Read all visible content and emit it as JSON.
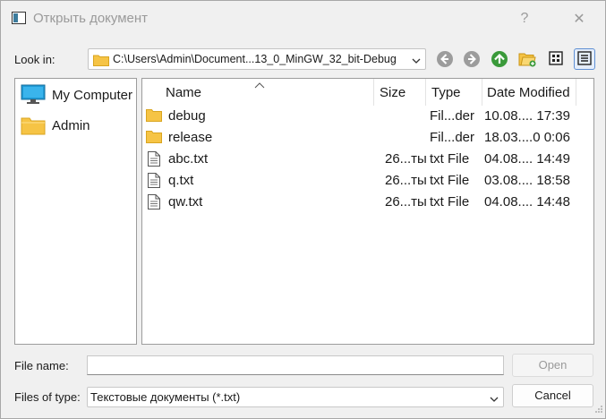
{
  "window": {
    "title": "Открыть документ",
    "help_label": "?",
    "close_label": "✕"
  },
  "toolbar": {
    "look_in_label": "Look in:",
    "path": "C:\\Users\\Admin\\Document...13_0_MinGW_32_bit-Debug",
    "icons": [
      "back-arrow-icon",
      "forward-arrow-icon",
      "up-folder-icon",
      "new-folder-icon",
      "list-view-icon",
      "detail-view-icon"
    ]
  },
  "sidebar": {
    "items": [
      {
        "label": "My Computer",
        "icon": "computer-icon"
      },
      {
        "label": "Admin",
        "icon": "folder-icon"
      }
    ]
  },
  "file_view": {
    "columns": [
      "Name",
      "Size",
      "Type",
      "Date Modified"
    ],
    "rows": [
      {
        "name": "debug",
        "size": "",
        "type": "Fil...der",
        "date": "10.08.... 17:39",
        "icon": "folder-icon"
      },
      {
        "name": "release",
        "size": "",
        "type": "Fil...der",
        "date": "18.03....0 0:06",
        "icon": "folder-icon"
      },
      {
        "name": "abc.txt",
        "size": "26...ты",
        "type": "txt File",
        "date": "04.08.... 14:49",
        "icon": "text-file-icon"
      },
      {
        "name": "q.txt",
        "size": "26...ты",
        "type": "txt File",
        "date": "03.08.... 18:58",
        "icon": "text-file-icon"
      },
      {
        "name": "qw.txt",
        "size": "26...ты",
        "type": "txt File",
        "date": "04.08.... 14:48",
        "icon": "text-file-icon"
      }
    ]
  },
  "bottom": {
    "file_name_label": "File name:",
    "file_name_value": "",
    "open_label": "Open",
    "files_of_type_label": "Files of type:",
    "files_of_type_value": "Текстовые документы (*.txt)",
    "cancel_label": "Cancel"
  },
  "colors": {
    "folder": "#f6c445",
    "accent": "#5f8fd3",
    "up_arrow": "#3a9a3a"
  }
}
